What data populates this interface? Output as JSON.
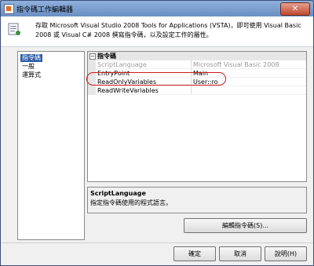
{
  "window": {
    "title": "指令碼工作編輯器",
    "close_glyph": "✕"
  },
  "header": {
    "text": "存取 Microsoft Visual Studio 2008 Tools for Applications (VSTA)，即可使用 Visual Basic 2008 或 Visual C# 2008 撰寫指令碼，以及設定工作的屬性。"
  },
  "nav": {
    "items": [
      {
        "label": "指令碼",
        "selected": true
      },
      {
        "label": "一般",
        "selected": false
      },
      {
        "label": "運算式",
        "selected": false
      }
    ]
  },
  "grid": {
    "category": {
      "label": "指令碼",
      "expander_glyph": "−"
    },
    "rows": [
      {
        "name": "ScriptLanguage",
        "value": "Microsoft Visual Basic 2008",
        "disabled": true
      },
      {
        "name": "EntryPoint",
        "value": "Main",
        "disabled": false
      },
      {
        "name": "ReadOnlyVariables",
        "value": "User::ro",
        "disabled": false
      },
      {
        "name": "ReadWriteVariables",
        "value": "",
        "disabled": false
      }
    ]
  },
  "description": {
    "title": "ScriptLanguage",
    "text": "指定指令碼使用的程式語言。"
  },
  "buttons": {
    "edit_script": "編輯指令碼(S)...",
    "ok": "確定",
    "cancel": "取消",
    "help": "說明(H)"
  },
  "colors": {
    "title_bar": "#6b8fc4",
    "selection": "#2e5ea8",
    "highlight_ring": "#d01a1a"
  }
}
